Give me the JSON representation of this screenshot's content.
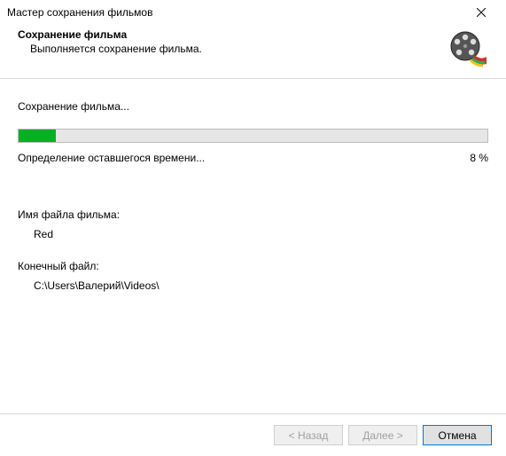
{
  "titlebar": {
    "title": "Мастер сохранения фильмов"
  },
  "header": {
    "title": "Сохранение фильма",
    "subtitle": "Выполняется сохранение фильма."
  },
  "progress": {
    "status_label": "Сохранение фильма...",
    "time_label": "Определение оставшегося времени...",
    "percent_text": "8 %",
    "percent_value": 8
  },
  "fields": {
    "filename_label": "Имя файла фильма:",
    "filename_value": "Red",
    "destination_label": "Конечный файл:",
    "destination_value": "C:\\Users\\Валерий\\Videos\\"
  },
  "footer": {
    "back": "< Назад",
    "next": "Далее >",
    "cancel": "Отмена"
  }
}
